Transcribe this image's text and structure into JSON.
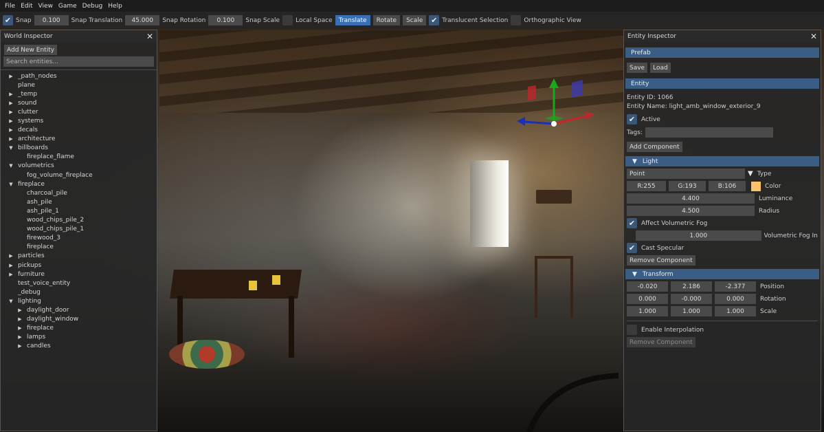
{
  "menu": [
    "File",
    "Edit",
    "View",
    "Game",
    "Debug",
    "Help"
  ],
  "toolbar": {
    "snap_label": "Snap",
    "snap_value": "0.100",
    "snap_translation_label": "Snap Translation",
    "snap_translation_value": "45.000",
    "snap_rotation_label": "Snap Rotation",
    "snap_rotation_value": "0.100",
    "snap_scale_label": "Snap Scale",
    "local_space_label": "Local Space",
    "translate_label": "Translate",
    "rotate_label": "Rotate",
    "scale_label": "Scale",
    "translucent_label": "Translucent Selection",
    "ortho_label": "Orthographic View"
  },
  "world": {
    "title": "World Inspector",
    "add_label": "Add New Entity",
    "search_placeholder": "Search entities...",
    "tree": [
      {
        "label": "_path_nodes",
        "depth": 0,
        "arrow": "right"
      },
      {
        "label": "plane",
        "depth": 0,
        "arrow": ""
      },
      {
        "label": "_temp",
        "depth": 0,
        "arrow": "right"
      },
      {
        "label": "sound",
        "depth": 0,
        "arrow": "right"
      },
      {
        "label": "clutter",
        "depth": 0,
        "arrow": "right"
      },
      {
        "label": "systems",
        "depth": 0,
        "arrow": "right"
      },
      {
        "label": "decals",
        "depth": 0,
        "arrow": "right"
      },
      {
        "label": "architecture",
        "depth": 0,
        "arrow": "right"
      },
      {
        "label": "billboards",
        "depth": 0,
        "arrow": "down"
      },
      {
        "label": "fireplace_flame",
        "depth": 1,
        "arrow": ""
      },
      {
        "label": "volumetrics",
        "depth": 0,
        "arrow": "down"
      },
      {
        "label": "fog_volume_fireplace",
        "depth": 1,
        "arrow": ""
      },
      {
        "label": "fireplace",
        "depth": 0,
        "arrow": "down"
      },
      {
        "label": "charcoal_pile",
        "depth": 1,
        "arrow": ""
      },
      {
        "label": "ash_pile",
        "depth": 1,
        "arrow": ""
      },
      {
        "label": "ash_pile_1",
        "depth": 1,
        "arrow": ""
      },
      {
        "label": "wood_chips_pile_2",
        "depth": 1,
        "arrow": ""
      },
      {
        "label": "wood_chips_pile_1",
        "depth": 1,
        "arrow": ""
      },
      {
        "label": "firewood_3",
        "depth": 1,
        "arrow": ""
      },
      {
        "label": "fireplace",
        "depth": 1,
        "arrow": ""
      },
      {
        "label": "particles",
        "depth": 0,
        "arrow": "right"
      },
      {
        "label": "pickups",
        "depth": 0,
        "arrow": "right"
      },
      {
        "label": "furniture",
        "depth": 0,
        "arrow": "right"
      },
      {
        "label": "test_voice_entity",
        "depth": 0,
        "arrow": ""
      },
      {
        "label": "_debug",
        "depth": 0,
        "arrow": ""
      },
      {
        "label": "lighting",
        "depth": 0,
        "arrow": "down"
      },
      {
        "label": "daylight_door",
        "depth": 1,
        "arrow": "right"
      },
      {
        "label": "daylight_window",
        "depth": 1,
        "arrow": "right"
      },
      {
        "label": "fireplace",
        "depth": 1,
        "arrow": "right"
      },
      {
        "label": "lamps",
        "depth": 1,
        "arrow": "right"
      },
      {
        "label": "candles",
        "depth": 1,
        "arrow": "right"
      }
    ]
  },
  "entity": {
    "title": "Entity Inspector",
    "prefab_header": "Prefab",
    "save_label": "Save",
    "load_label": "Load",
    "entity_header": "Entity",
    "entity_id": "Entity ID: 1066",
    "entity_name": "Entity Name: light_amb_window_exterior_9",
    "active_label": "Active",
    "tags_label": "Tags:",
    "add_component_label": "Add Component",
    "light_header": "Light",
    "type_value": "Point",
    "type_label": "Type",
    "color_r": "R:255",
    "color_g": "G:193",
    "color_b": "B:106",
    "color_hex": "#ffc16a",
    "color_label": "Color",
    "luminance_value": "4.400",
    "luminance_label": "Luminance",
    "radius_value": "4.500",
    "radius_label": "Radius",
    "affect_fog_label": "Affect Volumetric Fog",
    "fog_intensity_value": "1.000",
    "fog_intensity_label": "Volumetric Fog Inter",
    "cast_specular_label": "Cast Specular",
    "remove_component_label": "Remove Component",
    "transform_header": "Transform",
    "position": [
      "-0.020",
      "2.186",
      "-2.377"
    ],
    "position_label": "Position",
    "rotation": [
      "0.000",
      "-0.000",
      "0.000"
    ],
    "rotation_label": "Rotation",
    "scale": [
      "1.000",
      "1.000",
      "1.000"
    ],
    "scale_label": "Scale",
    "interp_label": "Enable Interpolation",
    "remove_component2_label": "Remove Component"
  },
  "colors": {
    "accent": "#3b6fb3",
    "header": "#3a5d86",
    "gizmo_x": "#c0262a",
    "gizmo_y": "#1aa81a",
    "gizmo_z": "#1c2fb8"
  }
}
